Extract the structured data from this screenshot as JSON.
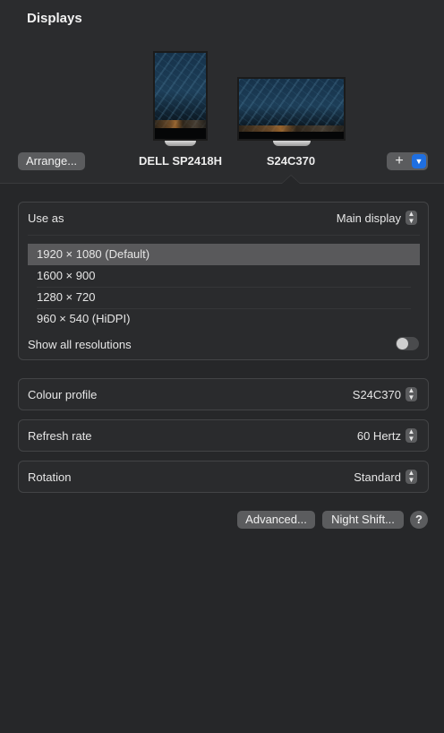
{
  "header": {
    "title": "Displays"
  },
  "displays": [
    {
      "label": "DELL SP2418H"
    },
    {
      "label": "S24C370"
    }
  ],
  "toolbar": {
    "arrange_label": "Arrange...",
    "add_label": "+",
    "add_dropdown_icon": "chevron-down-icon"
  },
  "use_as": {
    "label": "Use as",
    "value": "Main display",
    "resolutions": [
      "1920 × 1080 (Default)",
      "1600 × 900",
      "1280 × 720",
      "960 × 540 (HiDPI)"
    ],
    "selected_index": 0,
    "show_all_label": "Show all resolutions",
    "show_all_enabled": false
  },
  "colour_profile": {
    "label": "Colour profile",
    "value": "S24C370"
  },
  "refresh_rate": {
    "label": "Refresh rate",
    "value": "60 Hertz"
  },
  "rotation": {
    "label": "Rotation",
    "value": "Standard"
  },
  "footer": {
    "advanced_label": "Advanced...",
    "night_shift_label": "Night Shift...",
    "help_label": "?"
  },
  "colors": {
    "background": "#262729",
    "accent": "#1f6fe0",
    "button": "#5b5c5e",
    "selection": "#59595b"
  }
}
